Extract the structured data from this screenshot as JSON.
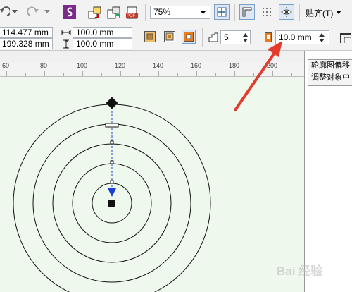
{
  "toolbar": {
    "zoom_value": "75%",
    "snap_label": "贴齐(T)",
    "colors": {
      "accent": "#7b2a8a",
      "arrow": "#e23b2e"
    }
  },
  "property_bar": {
    "x_value": "114.477 mm",
    "y_value": "199.328 mm",
    "width_value": "100.0 mm",
    "height_value": "100.0 mm",
    "steps_value": "5",
    "offset_value": "10.0 mm"
  },
  "ruler": {
    "ticks": [
      "60",
      "80",
      "100",
      "120",
      "140",
      "160",
      "180",
      "200"
    ]
  },
  "tooltip": {
    "line1": "轮廓图偏移",
    "line2": "调整对象中"
  },
  "watermark": {
    "text": "Bai 经验"
  }
}
